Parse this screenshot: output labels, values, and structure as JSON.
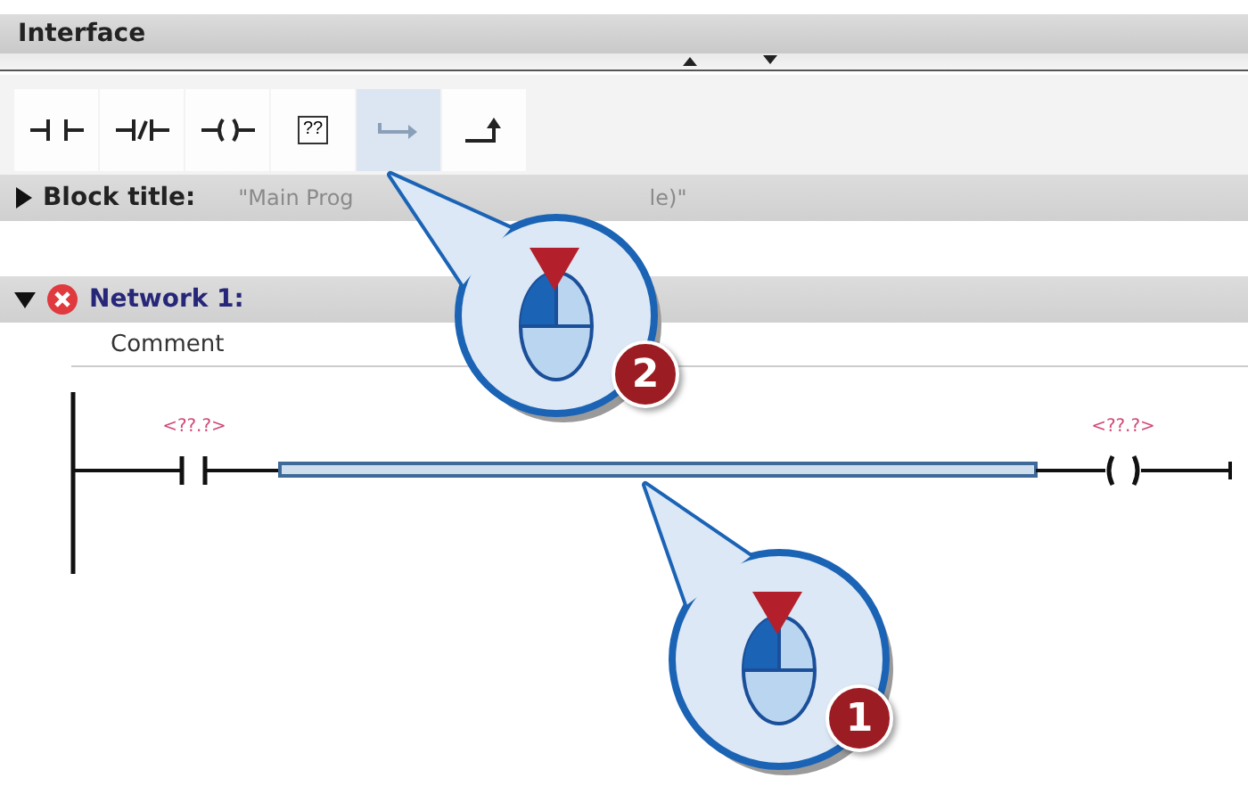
{
  "header": {
    "title": "Interface"
  },
  "toolbar": [
    {
      "kind": "no-contact",
      "selected": false
    },
    {
      "kind": "nc-contact",
      "selected": false
    },
    {
      "kind": "coil",
      "selected": false
    },
    {
      "kind": "empty-box",
      "label": "??",
      "selected": false
    },
    {
      "kind": "open-branch",
      "selected": true
    },
    {
      "kind": "close-branch",
      "selected": false
    }
  ],
  "block_title": {
    "label": "Block title:",
    "expanded": false,
    "value_parts": [
      "\"Main Prog",
      "le)\""
    ]
  },
  "network": {
    "title": "Network 1:",
    "expanded": true,
    "error": true,
    "comment": "Comment"
  },
  "rung": {
    "contact": {
      "operand": "<??.?>"
    },
    "coil": {
      "operand": "<??.?>"
    },
    "wire_selected": true
  },
  "callouts": [
    {
      "number": "2"
    },
    {
      "number": "1"
    }
  ]
}
